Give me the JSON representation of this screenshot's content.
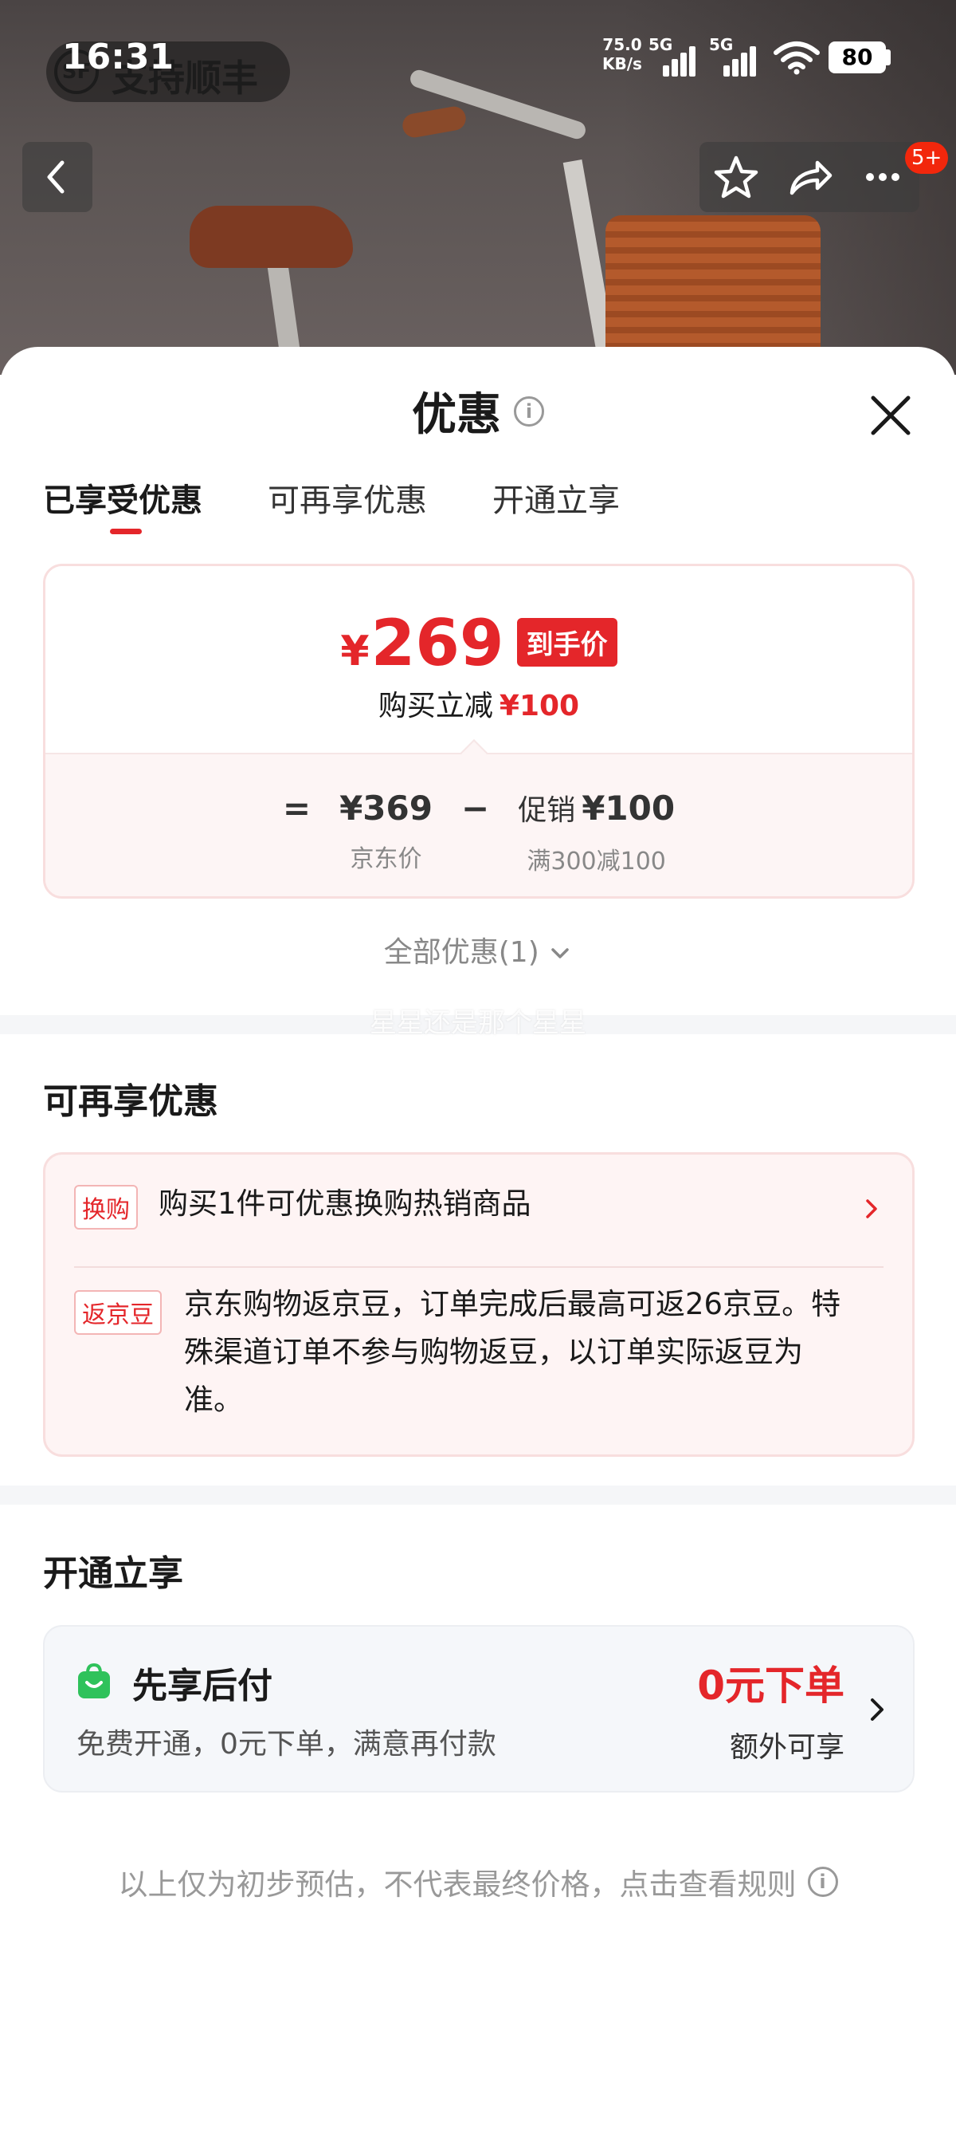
{
  "status_bar": {
    "time": "16:31",
    "net_speed_value": "75.0",
    "net_speed_unit": "KB/s",
    "sim1": "5G",
    "sim2": "5G",
    "battery": "80"
  },
  "overlay": {
    "sf_logo_text": "SF",
    "sf_badge_text": "支持顺丰",
    "nav_badge": "5+"
  },
  "sheet": {
    "title": "优惠",
    "tabs": [
      "已享受优惠",
      "可再享优惠",
      "开通立享"
    ],
    "active_tab_index": 0
  },
  "price_card": {
    "currency": "¥",
    "final_price": "269",
    "final_tag": "到手价",
    "reduce_label": "购买立减",
    "reduce_amount": "¥100",
    "equals": "=",
    "base_price": "¥369",
    "base_label": "京东价",
    "minus": "−",
    "promo_prefix": "促销",
    "promo_amount": "¥100",
    "promo_label": "满300减100"
  },
  "all_discount_label": "全部优惠(1)",
  "watermark": "星星还是那个星星",
  "extra_section": {
    "title": "可再享优惠",
    "offers": [
      {
        "tag": "换购",
        "text": "购买1件可优惠换购热销商品"
      },
      {
        "tag": "返京豆",
        "text_lines": [
          "京东购物返京豆，订单完成后最高可返26京豆。特",
          "殊渠道订单不参与购物返豆，以订单实际返豆为",
          "准。"
        ]
      }
    ]
  },
  "open_section": {
    "title": "开通立享",
    "card": {
      "name": "先享后付",
      "desc": "免费开通，0元下单，满意再付款",
      "right_big": "0元下单",
      "right_small": "额外可享"
    }
  },
  "footer_note": "以上仅为初步预估，不代表最终价格，点击查看规则",
  "colors": {
    "accent_red": "#e4262a",
    "pay_green": "#2fc25b"
  }
}
